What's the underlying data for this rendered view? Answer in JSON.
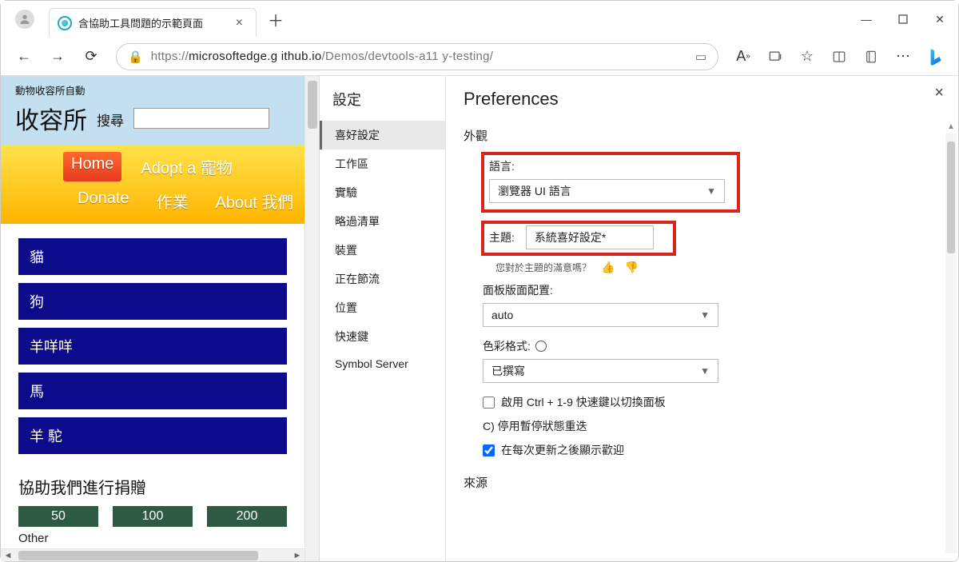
{
  "browser": {
    "tab_title": "含協助工具問題的示範頁面",
    "url_prefix": "https://",
    "url_host": "microsoftedge.g ithub.io",
    "url_path": "/Demos/devtools-a11 y-testing/"
  },
  "page": {
    "header_small": "動物收容所自動",
    "brand": "收容所",
    "search_label": "搜尋",
    "nav": {
      "home": "Home",
      "adopt": "Adopt a 寵物",
      "donate": "Donate",
      "jobs": "作業",
      "about": "About 我們"
    },
    "categories": [
      "貓",
      "狗",
      "羊咩咩",
      "馬",
      "羊 駝"
    ],
    "donate_heading": "協助我們進行捐贈",
    "amounts": [
      "50",
      "100",
      "200"
    ],
    "other": "Other"
  },
  "devtools": {
    "settings_title": "設定",
    "nav": [
      "喜好設定",
      "工作區",
      "實驗",
      "略過清單",
      "裝置",
      "正在節流",
      "位置",
      "快速鍵",
      "Symbol Server"
    ],
    "prefs_title": "Preferences",
    "appearance_heading": "外觀",
    "language_label": "語言:",
    "language_value": "瀏覽器 UI 語言",
    "theme_label": "主題:",
    "theme_value": "系統喜好設定*",
    "theme_feedback": "您對於主題的滿意嗎？",
    "panel_label": "面板版面配置:",
    "panel_value": "auto",
    "color_label": "色彩格式:",
    "color_value": "已撰寫",
    "chk_shortcut": "啟用 Ctrl + 1-9 快速鍵以切換面板",
    "chk_pause": "C) 停用暫停狀態重迭",
    "chk_welcome": "在每次更新之後顯示歡迎",
    "source_heading": "來源"
  }
}
